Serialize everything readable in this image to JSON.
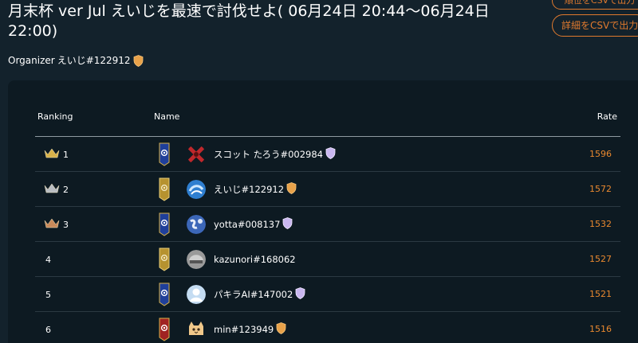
{
  "title": "月末杯 ver Jul えいじを最速で討伐せよ( 06月24日 20:44～06月24日 22:00)",
  "buttons": {
    "top_partial": "順位をCSVで出力",
    "csv": "詳細をCSVで出力"
  },
  "organizer": {
    "label": "Organizer",
    "name": "えいじ#122912",
    "badge_icon": "shield-orange-icon"
  },
  "table": {
    "headers": {
      "ranking": "Ranking",
      "name": "Name",
      "rate": "Rate"
    },
    "rows": [
      {
        "rank": "1",
        "crown": "gold",
        "banner": "blue",
        "avatar": "red-x",
        "name": "スコット たろう#002984",
        "badge": "shield-lilac",
        "rate": "1596"
      },
      {
        "rank": "2",
        "crown": "silver",
        "banner": "gold",
        "avatar": "blue-swirl",
        "name": "えいじ#122912",
        "badge": "shield-orange",
        "rate": "1572"
      },
      {
        "rank": "3",
        "crown": "bronze",
        "banner": "blue",
        "avatar": "earth",
        "name": "yotta#008137",
        "badge": "shield-lilac",
        "rate": "1532"
      },
      {
        "rank": "4",
        "crown": "",
        "banner": "gold",
        "avatar": "grey-helmet",
        "name": "kazunori#168062",
        "badge": "",
        "rate": "1527"
      },
      {
        "rank": "5",
        "crown": "",
        "banner": "blue",
        "avatar": "default-person",
        "name": "パキラAI#147002",
        "badge": "shield-lilac",
        "rate": "1521"
      },
      {
        "rank": "6",
        "crown": "",
        "banner": "red",
        "avatar": "cat",
        "name": "min#123949",
        "badge": "shield-orange",
        "rate": "1516"
      }
    ]
  },
  "colors": {
    "background": "#13222c",
    "panel": "#0d1a22",
    "accent": "#e8882f",
    "crown_gold": "#d8b24a",
    "crown_silver": "#b9bdc2",
    "crown_bronze": "#c98a5a"
  }
}
